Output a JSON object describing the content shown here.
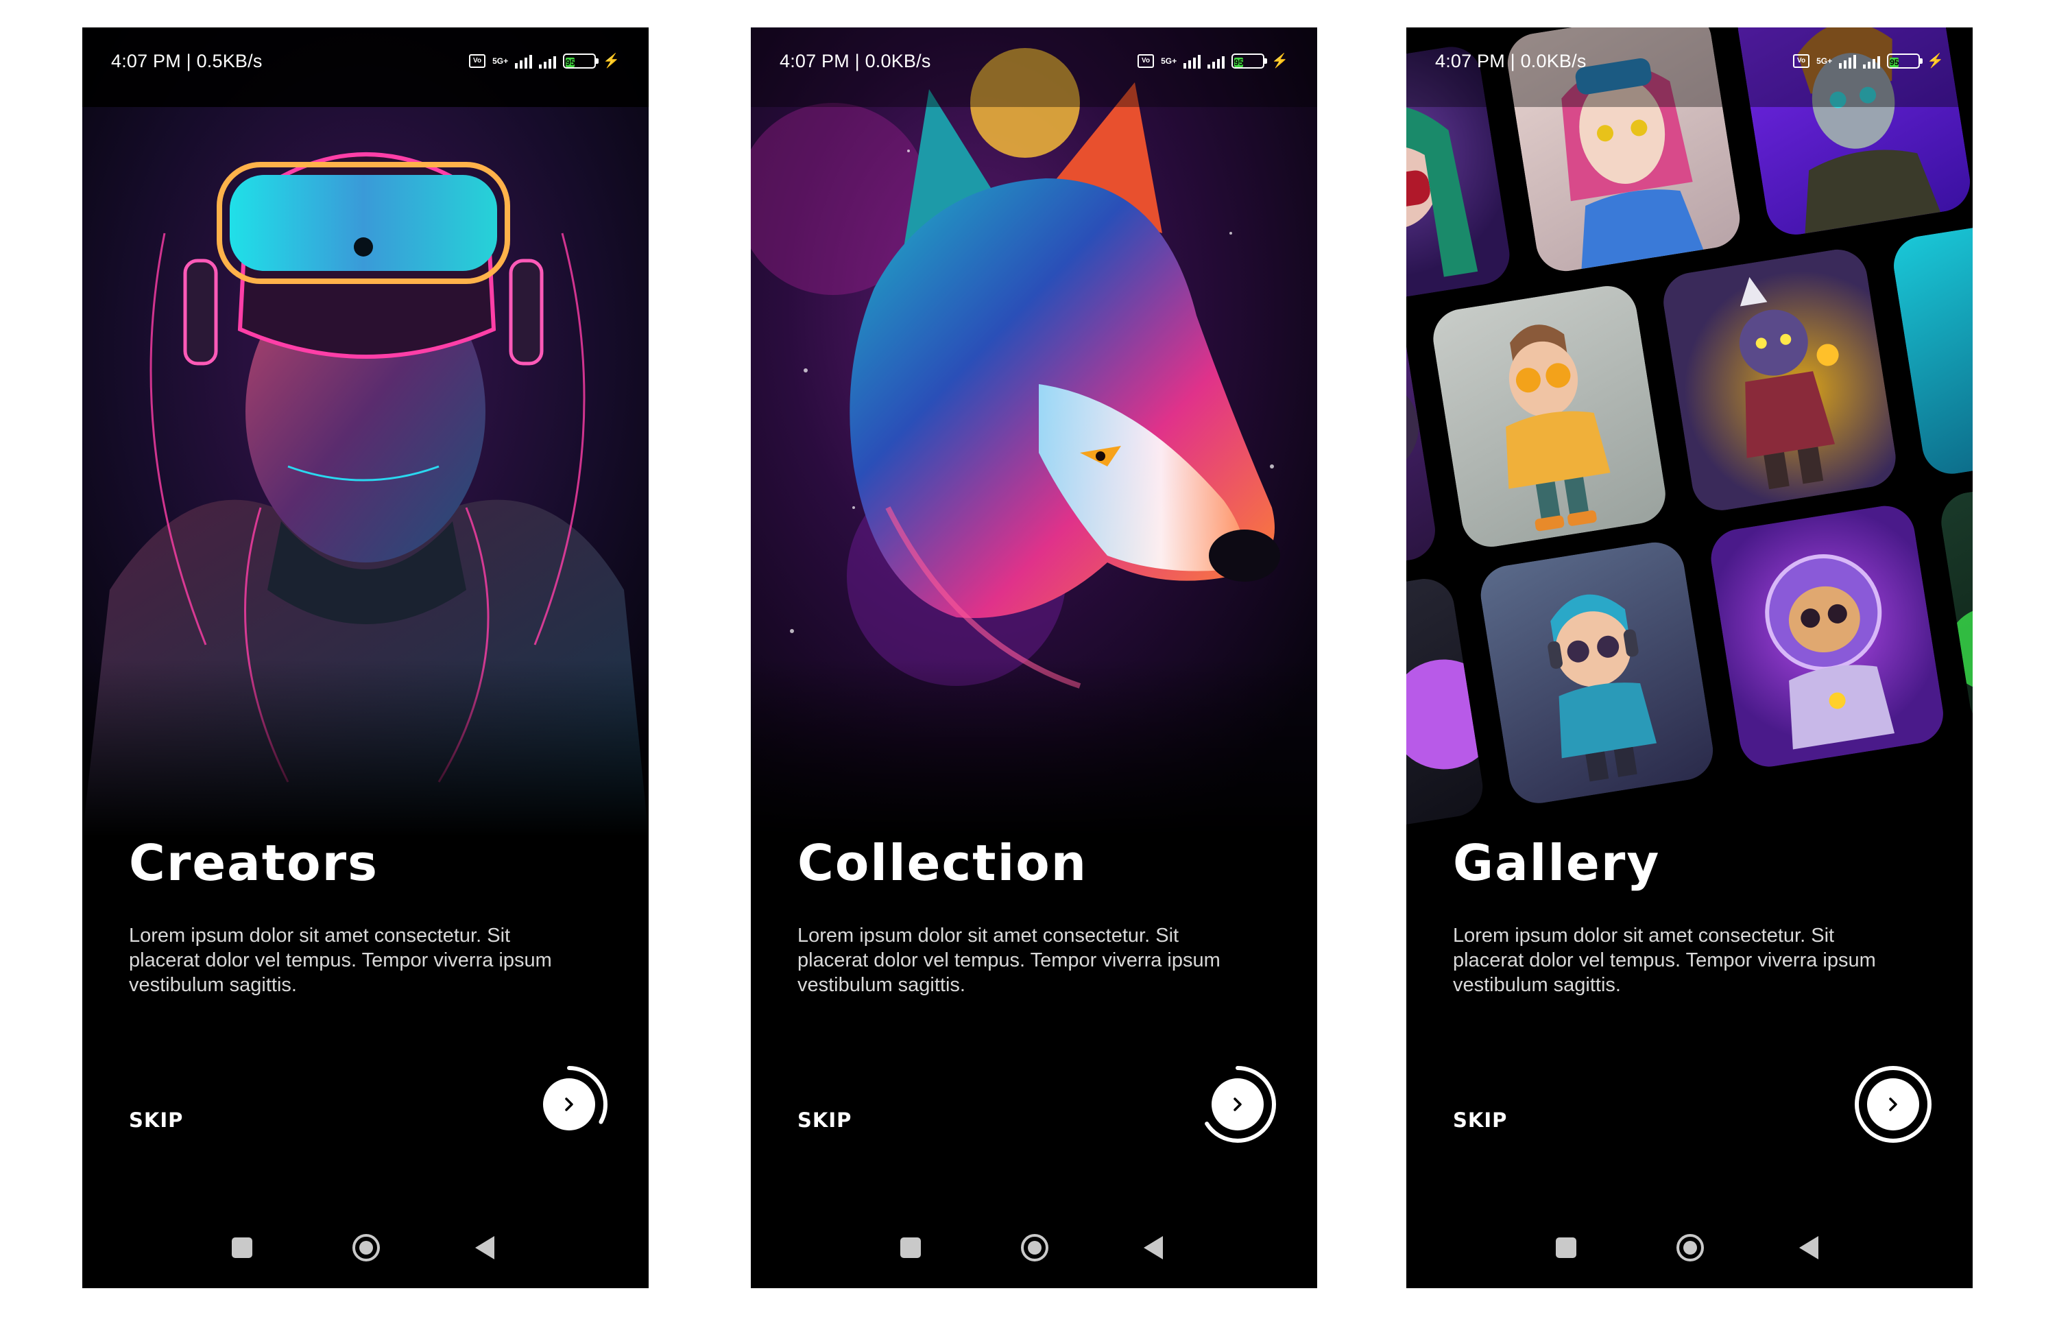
{
  "screens": [
    {
      "status_text": "4:07 PM | 0.5KB/s",
      "battery": "95",
      "title": "Creators",
      "description": "Lorem ipsum dolor sit amet consectetur. Sit placerat dolor vel tempus. Tempor viverra ipsum vestibulum sagittis.",
      "skip_label": "SKIP",
      "progress": 0.33
    },
    {
      "status_text": "4:07 PM | 0.0KB/s",
      "battery": "95",
      "title": "Collection",
      "description": "Lorem ipsum dolor sit amet consectetur. Sit placerat dolor vel tempus. Tempor viverra ipsum vestibulum sagittis.",
      "skip_label": "SKIP",
      "progress": 0.66
    },
    {
      "status_text": "4:07 PM | 0.0KB/s",
      "battery": "95",
      "title": "Gallery",
      "description": "Lorem ipsum dolor sit amet consectetur. Sit placerat dolor vel tempus. Tempor viverra ipsum vestibulum sagittis.",
      "skip_label": "SKIP",
      "progress": 1.0
    }
  ],
  "colors": {
    "background": "#000000",
    "text": "#ffffff",
    "description": "#d9d9d9",
    "battery": "#43d742",
    "nav": "#c9c9c9"
  },
  "icons": {
    "next": "chevron-right-icon",
    "nav_recents": "square-icon",
    "nav_home": "circle-icon",
    "nav_back": "triangle-back-icon"
  }
}
